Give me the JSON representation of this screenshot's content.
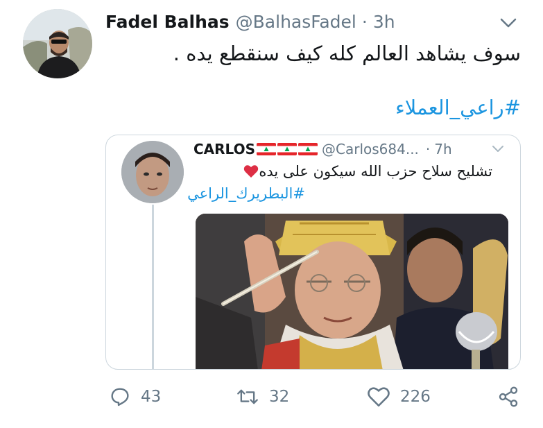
{
  "tweet": {
    "author": {
      "display_name": "Fadel Balhas",
      "handle": "@BalhasFadel",
      "separator": "·",
      "time": "3h"
    },
    "text": "سوف يشاهد العالم كله كيف سنقطع يده .",
    "hashtag": "#راعي_العملاء",
    "menu_icon": "chevron-down-icon"
  },
  "quoted_tweet": {
    "author": {
      "display_name": "CARLOS",
      "flags": [
        "lebanon-flag",
        "lebanon-flag",
        "lebanon-flag"
      ],
      "handle": "@Carlos684...",
      "separator": "·",
      "time": "7h"
    },
    "text": "تشليح سلاح حزب الله سيكون على يده",
    "emoji": "red-heart",
    "hashtag": "#البطريرك_الراعي",
    "media": "photo-patriarch-blessing"
  },
  "actions": {
    "reply": {
      "icon": "reply-icon",
      "count": "43"
    },
    "retweet": {
      "icon": "retweet-icon",
      "count": "32"
    },
    "like": {
      "icon": "heart-icon",
      "count": "226"
    },
    "share": {
      "icon": "share-icon"
    }
  },
  "colors": {
    "text": "#14171a",
    "secondary": "#657786",
    "link": "#1b95e0",
    "border": "#ccd6dd"
  }
}
